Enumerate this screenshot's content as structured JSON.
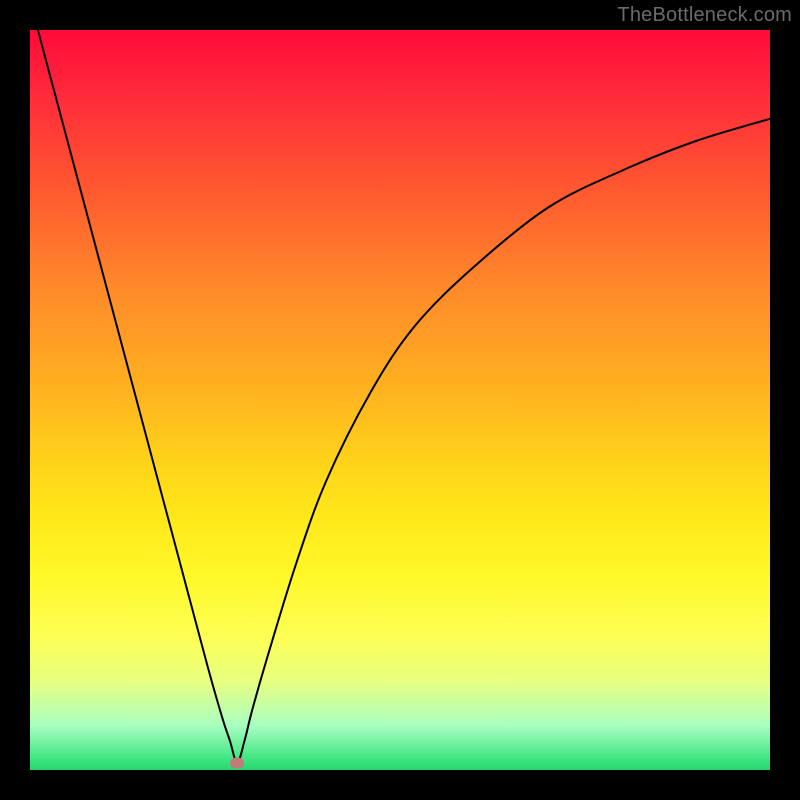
{
  "watermark": "TheBottleneck.com",
  "colors": {
    "background": "#000000",
    "curve": "#000000",
    "marker": "#c17b78"
  },
  "chart_data": {
    "type": "line",
    "title": "",
    "xlabel": "",
    "ylabel": "",
    "xlim": [
      0,
      100
    ],
    "ylim": [
      0,
      100
    ],
    "grid": false,
    "legend": false,
    "minimum": {
      "x": 28,
      "y": 1
    },
    "series": [
      {
        "name": "bottleneck-curve",
        "x": [
          0,
          4,
          8,
          12,
          16,
          20,
          24,
          26,
          27,
          28,
          29,
          30,
          32,
          36,
          40,
          46,
          52,
          60,
          70,
          80,
          90,
          100
        ],
        "y": [
          104,
          89,
          74,
          59,
          44,
          29,
          14,
          7,
          4,
          1,
          4,
          8,
          15,
          28,
          39,
          51,
          60,
          68,
          76,
          81,
          85,
          88
        ]
      }
    ],
    "annotations": [
      {
        "type": "marker",
        "x": 28,
        "y": 1,
        "color": "#c17b78"
      }
    ],
    "background_gradient": {
      "direction": "vertical",
      "stops": [
        {
          "pos": 0.0,
          "color": "#ff0a3a"
        },
        {
          "pos": 0.35,
          "color": "#ff8a2a"
        },
        {
          "pos": 0.66,
          "color": "#ffe81a"
        },
        {
          "pos": 0.94,
          "color": "#a8ffc0"
        },
        {
          "pos": 1.0,
          "color": "#2bd46e"
        }
      ]
    }
  }
}
